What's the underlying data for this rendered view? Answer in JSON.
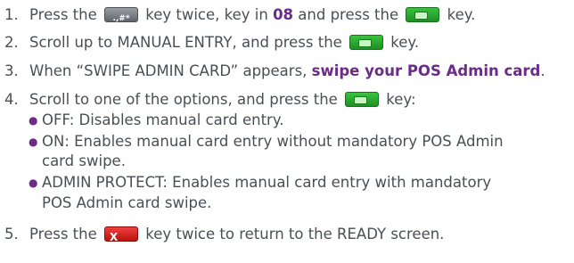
{
  "steps": [
    {
      "number": "1.",
      "t1": "Press the ",
      "t2": " key twice, key in ",
      "code": "08",
      "t3": " and press the ",
      "t4": " key.",
      "hash_key_label": ".,#*"
    },
    {
      "number": "2.",
      "t1": "Scroll up to MANUAL ENTRY, and press the ",
      "t2": " key."
    },
    {
      "number": "3.",
      "t1": "When “SWIPE ADMIN CARD” appears, ",
      "bold": "swipe your POS Admin card",
      "t2": "."
    },
    {
      "number": "4.",
      "t1": "Scroll to one of the options, and press the ",
      "t2": " key:",
      "options": [
        {
          "line1": "OFF: Disables manual card entry."
        },
        {
          "line1": "ON: Enables manual card entry without mandatory POS Admin",
          "line2": "card swipe."
        },
        {
          "line1": "ADMIN PROTECT: Enables manual card entry with mandatory",
          "line2": "POS Admin card swipe."
        }
      ]
    },
    {
      "number": "5.",
      "t1": "Press the ",
      "t2": " key twice to return to the READY screen.",
      "cancel_key_label": "X"
    }
  ],
  "colors": {
    "text": "#4a4f54",
    "emphasis": "#6a2c86",
    "enter_key": "#2aa530",
    "cancel_key": "#d9201d",
    "function_key": "#7a8086"
  },
  "icons": {
    "function_key": "hash-key-icon",
    "enter_key": "green-enter-key-icon",
    "cancel_key": "red-cancel-key-icon",
    "bullet": "bullet-icon"
  }
}
